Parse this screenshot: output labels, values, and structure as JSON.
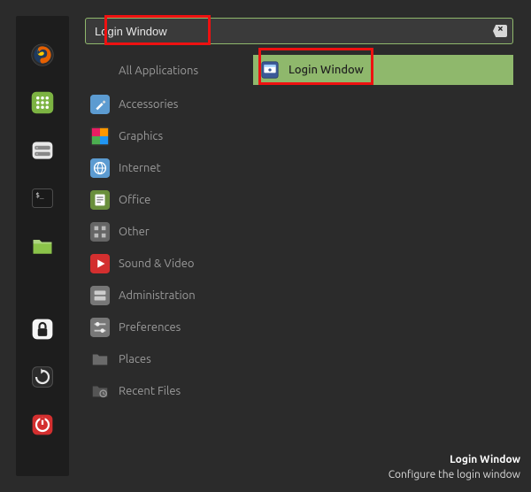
{
  "search": {
    "value": "Login Window"
  },
  "categories": [
    {
      "label": "All Applications",
      "icon": "none"
    },
    {
      "label": "Accessories",
      "icon": "accessories"
    },
    {
      "label": "Graphics",
      "icon": "graphics"
    },
    {
      "label": "Internet",
      "icon": "internet"
    },
    {
      "label": "Office",
      "icon": "office"
    },
    {
      "label": "Other",
      "icon": "other"
    },
    {
      "label": "Sound & Video",
      "icon": "media"
    },
    {
      "label": "Administration",
      "icon": "admin"
    },
    {
      "label": "Preferences",
      "icon": "prefs"
    },
    {
      "label": "Places",
      "icon": "folder"
    },
    {
      "label": "Recent Files",
      "icon": "recent"
    }
  ],
  "results": [
    {
      "label": "Login Window",
      "icon": "login"
    }
  ],
  "footer": {
    "title": "Login Window",
    "desc": "Configure the login window"
  },
  "panel": [
    "firefox",
    "app-grid",
    "disks",
    "terminal",
    "files",
    "lock",
    "restart",
    "power"
  ],
  "annotations": {
    "search_box": true,
    "result_box": true
  }
}
